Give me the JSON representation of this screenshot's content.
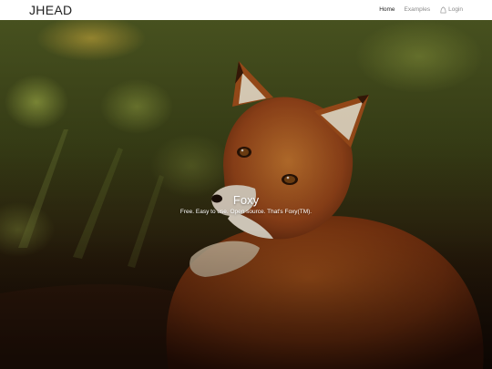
{
  "navbar": {
    "brand": "JHEAD",
    "links": [
      {
        "label": "Home",
        "active": true
      },
      {
        "label": "Examples",
        "active": false
      },
      {
        "label": "Login",
        "icon": "user-outline-icon",
        "active": false
      }
    ]
  },
  "hero": {
    "image": "fox-photo",
    "title": "Foxy",
    "subtitle": "Free. Easy to use. Open source. That's Foxy(TM)."
  },
  "colors": {
    "nav_active": "#222222",
    "nav_inactive": "#8a8a8a",
    "hero_text": "#ffffff"
  }
}
